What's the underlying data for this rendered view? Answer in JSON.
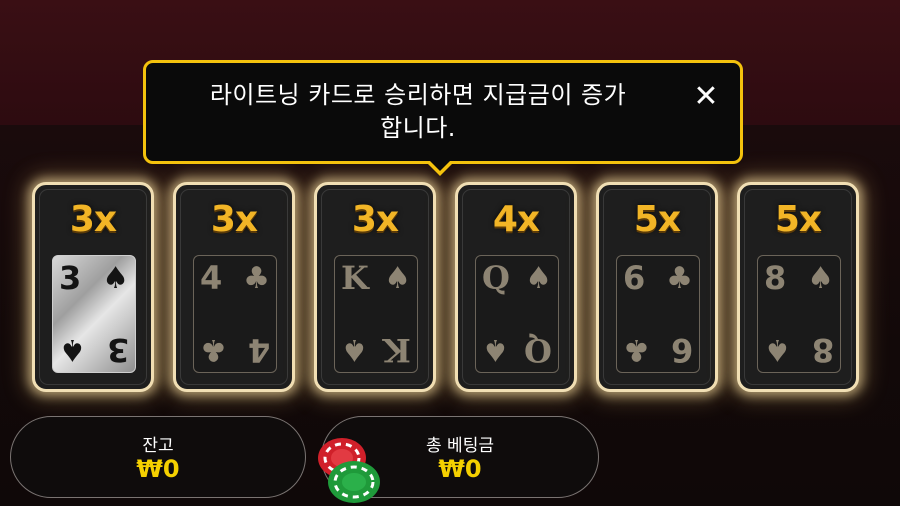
{
  "tooltip": {
    "line1": "라이트닝 카드로 승리하면 지급금이 증가",
    "line2": "합니다.",
    "close_symbol": "✕"
  },
  "cards": [
    {
      "multiplier": "3x",
      "rank": "3",
      "suit": "♠",
      "highlighted": true
    },
    {
      "multiplier": "3x",
      "rank": "4",
      "suit": "♣",
      "highlighted": false
    },
    {
      "multiplier": "3x",
      "rank": "K",
      "suit": "♠",
      "highlighted": false
    },
    {
      "multiplier": "4x",
      "rank": "Q",
      "suit": "♠",
      "highlighted": false
    },
    {
      "multiplier": "5x",
      "rank": "6",
      "suit": "♣",
      "highlighted": false
    },
    {
      "multiplier": "5x",
      "rank": "8",
      "suit": "♠",
      "highlighted": false
    }
  ],
  "balance": {
    "label": "잔고",
    "value": "₩0"
  },
  "total_bet": {
    "label": "총 베팅금",
    "value": "₩0",
    "icon": "chips-icon"
  },
  "colors": {
    "accent": "#f4c20d",
    "value": "#f5d000",
    "multiplier": "#f2b526",
    "chip_red": "#d0202a",
    "chip_green": "#1f9a3a"
  }
}
